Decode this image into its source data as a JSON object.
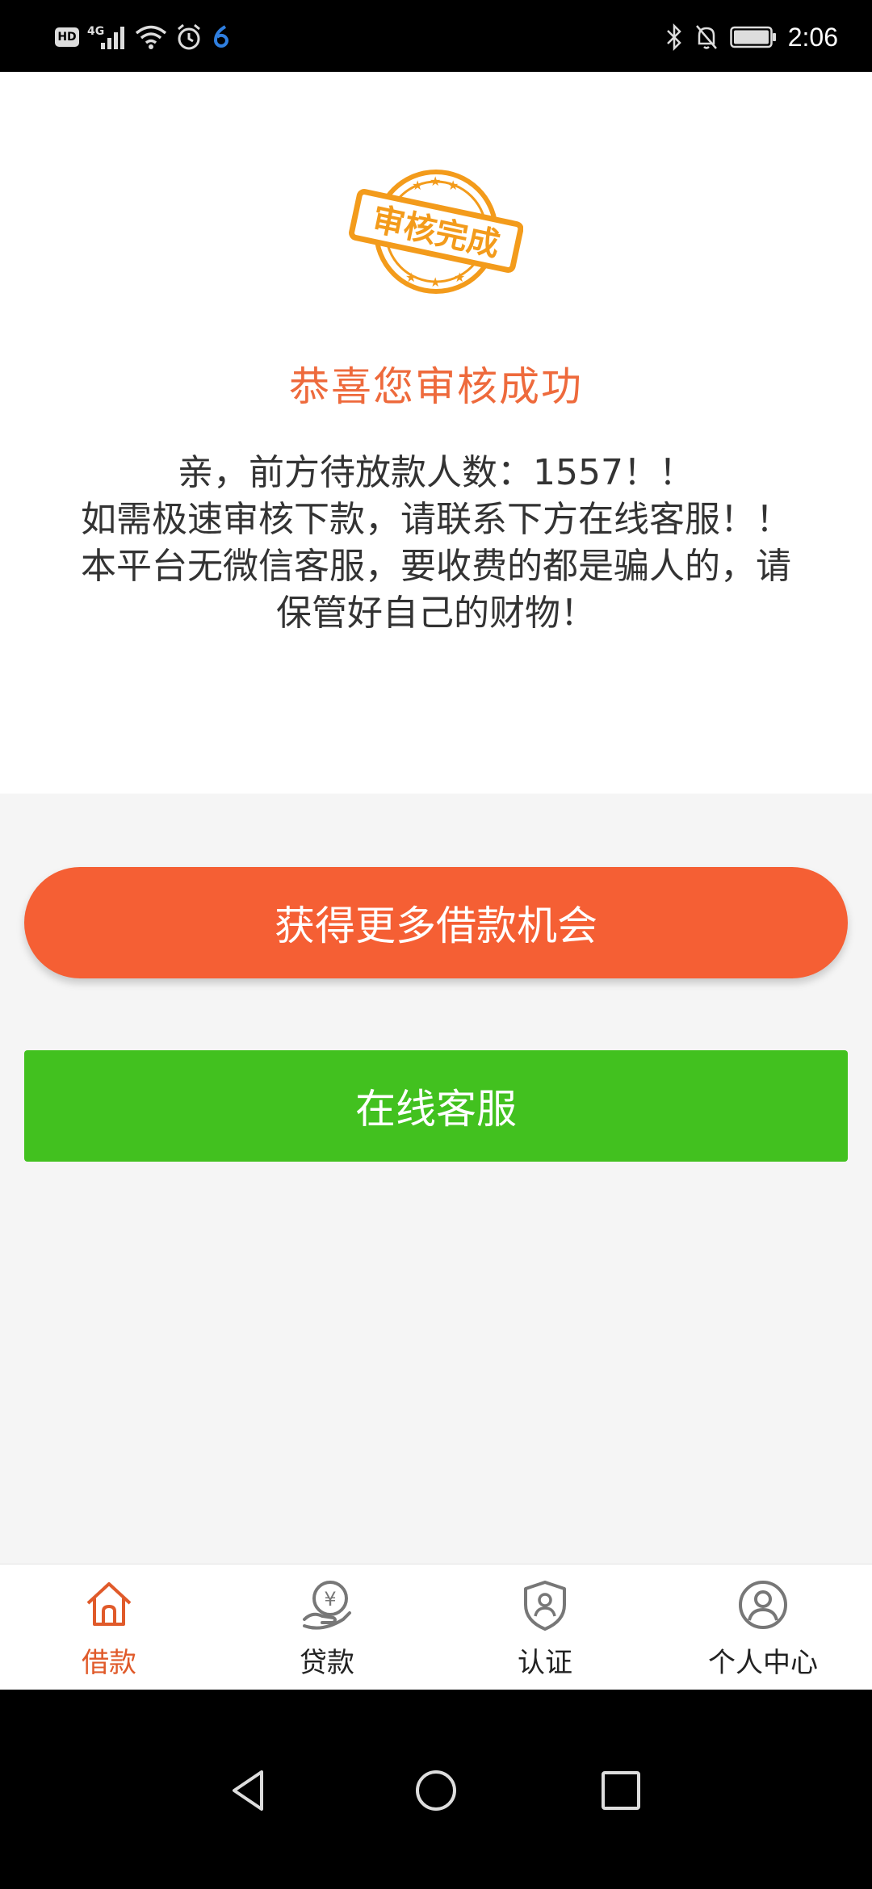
{
  "status_bar": {
    "left_icons": [
      "hd-icon",
      "signal-4g-icon",
      "wifi-icon",
      "alarm-icon",
      "app-notification-icon"
    ],
    "hd_label": "HD",
    "network_label": "4G",
    "right_icons": [
      "bluetooth-icon",
      "mute-icon",
      "battery-icon"
    ],
    "time": "2:06"
  },
  "result": {
    "stamp_text": "审核完成",
    "title": "恭喜您审核成功",
    "notice_lines": [
      "亲，前方待放款人数：1557！！",
      "如需极速审核下款，请联系下方在线客服！！",
      "本平台无微信客服，要收费的都是骗人的，请",
      "保管好自己的财物！"
    ]
  },
  "actions": {
    "more_loans_label": "获得更多借款机会",
    "online_service_label": "在线客服"
  },
  "bottom_nav": {
    "items": [
      {
        "label": "借款",
        "icon": "home-icon",
        "active": true
      },
      {
        "label": "贷款",
        "icon": "yuan-hand-icon",
        "active": false
      },
      {
        "label": "认证",
        "icon": "shield-user-icon",
        "active": false
      },
      {
        "label": "个人中心",
        "icon": "user-circle-icon",
        "active": false
      }
    ]
  },
  "colors": {
    "accent": "#ee6a3c",
    "primary_button": "#f55f34",
    "service_button": "#42c11f",
    "stamp": "#f39b1b",
    "nav_active": "#e05a2a"
  },
  "system_nav": [
    "back-icon",
    "home-circle-icon",
    "recents-icon"
  ]
}
